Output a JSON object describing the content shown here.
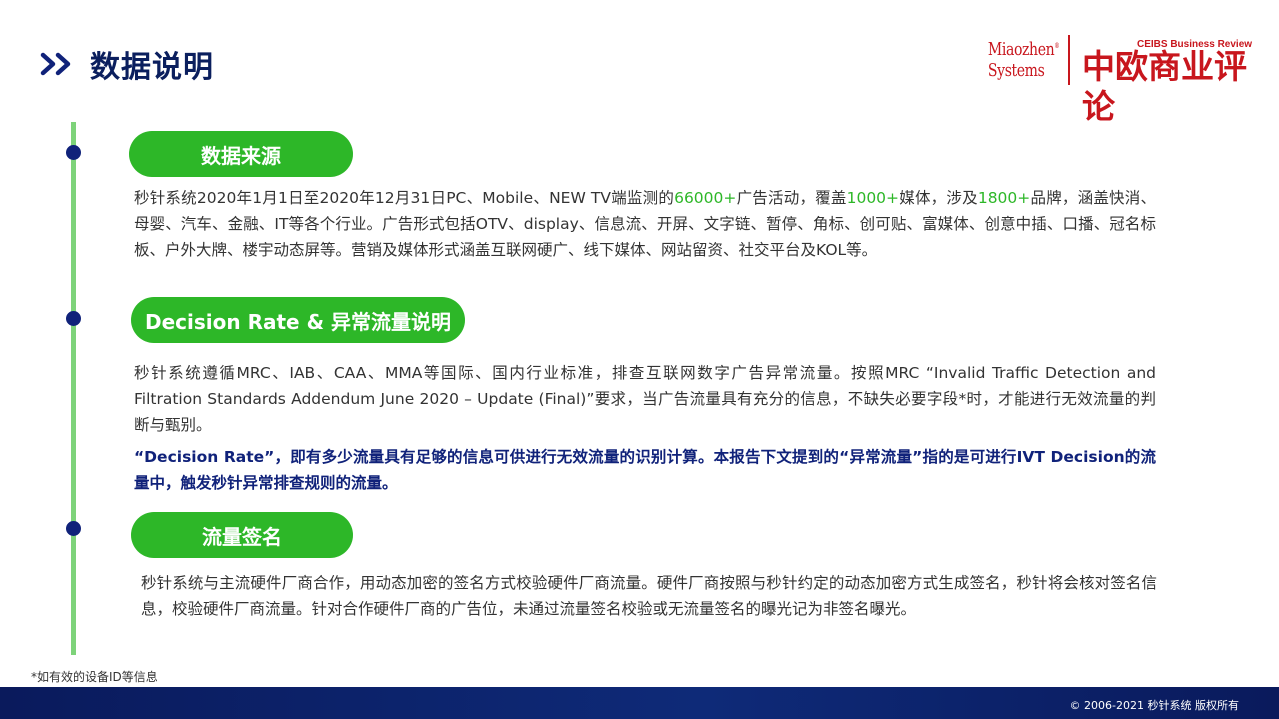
{
  "header": {
    "title": "数据说明"
  },
  "logos": {
    "miaozhen_line1": "Miaozhen",
    "miaozhen_mark": "®",
    "miaozhen_line2": "Systems",
    "ceibs_en": "CEIBS Business Review",
    "ceibs_cn": "中欧商业评论"
  },
  "sections": {
    "source": {
      "label": "数据来源",
      "p1": "秒针系统2020年1月1日至2020年12月31日PC、Mobile、NEW TV端监测的",
      "h1": "66000+",
      "p2": "广告活动，覆盖",
      "h2": "1000+",
      "p3": "媒体，涉及",
      "h3": "1800+",
      "p4": "品牌，涵盖快消、母婴、汽车、金融、IT等各个行业。广告形式包括OTV、display、信息流、开屏、文字链、暂停、角标、创可贴、富媒体、创意中插、口播、冠名标板、户外大牌、楼宇动态屏等。营销及媒体形式涵盖互联网硬广、线下媒体、网站留资、社交平台及KOL等。"
    },
    "decision": {
      "label": "Decision Rate & 异常流量说明",
      "body": "秒针系统遵循MRC、IAB、CAA、MMA等国际、国内行业标准，排查互联网数字广告异常流量。按照MRC “Invalid Traffic Detection and Filtration Standards Addendum June 2020 – Update (Final)”要求，当广告流量具有充分的信息，不缺失必要字段*时，才能进行无效流量的判断与甄别。",
      "emphasis": "“Decision Rate”，即有多少流量具有足够的信息可供进行无效流量的识别计算。本报告下文提到的“异常流量”指的是可进行IVT Decision的流量中，触发秒针异常排查规则的流量。"
    },
    "signature": {
      "label": "流量签名",
      "body": "秒针系统与主流硬件厂商合作，用动态加密的签名方式校验硬件厂商流量。硬件厂商按照与秒针约定的动态加密方式生成签名，秒针将会核对签名信息，校验硬件厂商流量。针对合作硬件厂商的广告位，未通过流量签名校验或无流量签名的曝光记为非签名曝光。"
    }
  },
  "footnote": "*如有效的设备ID等信息",
  "footer": {
    "copyright": "© 2006-2021 秒针系统 版权所有"
  },
  "colors": {
    "navy": "#10227a",
    "green": "#2db728",
    "timeline": "#7ed37a",
    "brand_red": "#c8161d"
  }
}
